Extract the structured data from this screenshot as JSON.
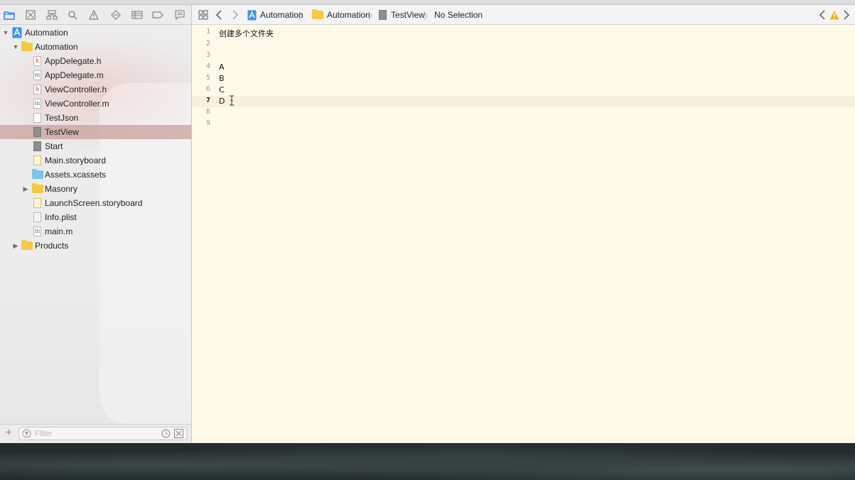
{
  "navigator": {
    "tabs": [
      {
        "icon": "project-navigator-icon"
      },
      {
        "icon": "source-control-icon"
      },
      {
        "icon": "symbol-navigator-icon"
      },
      {
        "icon": "find-navigator-icon"
      },
      {
        "icon": "issue-navigator-icon"
      },
      {
        "icon": "test-navigator-icon"
      },
      {
        "icon": "debug-navigator-icon"
      },
      {
        "icon": "breakpoint-navigator-icon"
      },
      {
        "icon": "report-navigator-icon"
      }
    ],
    "tree": [
      {
        "label": "Automation",
        "kind": "project",
        "expanded": true
      },
      {
        "label": "Automation",
        "kind": "folder",
        "expanded": true
      },
      {
        "label": "AppDelegate.h",
        "kind": "h"
      },
      {
        "label": "AppDelegate.m",
        "kind": "m"
      },
      {
        "label": "ViewController.h",
        "kind": "h"
      },
      {
        "label": "ViewController.m",
        "kind": "m"
      },
      {
        "label": "TestJson",
        "kind": "plain"
      },
      {
        "label": "TestView",
        "kind": "plain-dark",
        "selected": true
      },
      {
        "label": "Start",
        "kind": "plain-dark"
      },
      {
        "label": "Main.storyboard",
        "kind": "storyboard"
      },
      {
        "label": "Assets.xcassets",
        "kind": "assets"
      },
      {
        "label": "Masonry",
        "kind": "folder",
        "expanded": false
      },
      {
        "label": "LaunchScreen.storyboard",
        "kind": "storyboard"
      },
      {
        "label": "Info.plist",
        "kind": "plist"
      },
      {
        "label": "main.m",
        "kind": "m"
      },
      {
        "label": "Products",
        "kind": "folder",
        "expanded": false
      }
    ],
    "filter": {
      "placeholder": "Filter"
    }
  },
  "jump_bar": {
    "crumbs": [
      "Automation",
      "Automation",
      "TestView",
      "No Selection"
    ]
  },
  "editor": {
    "current_line": 7,
    "lines": [
      {
        "num": "1",
        "text": "创建多个文件夹"
      },
      {
        "num": "2",
        "text": ""
      },
      {
        "num": "3",
        "text": ""
      },
      {
        "num": "4",
        "text": "A"
      },
      {
        "num": "5",
        "text": "B"
      },
      {
        "num": "6",
        "text": "C"
      },
      {
        "num": "7",
        "text": "D"
      },
      {
        "num": "8",
        "text": ""
      },
      {
        "num": "9",
        "text": ""
      }
    ]
  },
  "colors": {
    "editor_bg": "#fffbe8",
    "selection": "#c8a09b",
    "warning": "#f5b400",
    "folder": "#f6c940"
  }
}
